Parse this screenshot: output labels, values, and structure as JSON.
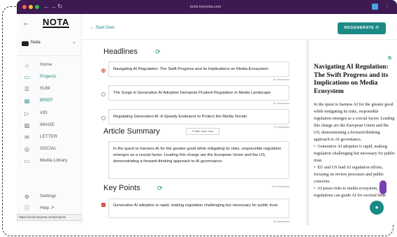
{
  "browser": {
    "url": "tools.heynota.com",
    "status_url": "https://tools.heynota.com/projects"
  },
  "sidebar": {
    "logo": "NOTA",
    "workspace": "Nota",
    "items": [
      {
        "label": "Home",
        "icon": "home-icon"
      },
      {
        "label": "Projects",
        "icon": "folder-icon",
        "active": true
      },
      {
        "label": "SUM",
        "icon": "list-icon"
      },
      {
        "label": "BRIEF",
        "icon": "document-icon",
        "active": true
      },
      {
        "label": "VID",
        "icon": "video-icon"
      },
      {
        "label": "IMAGE",
        "icon": "image-icon"
      },
      {
        "label": "LETTER",
        "icon": "mail-icon"
      },
      {
        "label": "SOCIAL",
        "icon": "social-icon"
      },
      {
        "label": "Media Library",
        "icon": "folder-icon"
      },
      {
        "label": "Settings",
        "icon": "gear-icon"
      },
      {
        "label": "Help ↗",
        "icon": "help-icon"
      }
    ]
  },
  "topbar": {
    "back_label": "Start Over",
    "regenerate_label": "REGENERATE"
  },
  "headlines": {
    "title": "Headlines",
    "items": [
      {
        "text": "Navigating AI Regulation: The Swift Progress and its Implications on Media Ecosystem",
        "chars": "84 characters",
        "selected": true
      },
      {
        "text": "The Surge in Generative AI Adoption Demands Prudent Regulation in Media Landscape",
        "chars": "81 characters",
        "selected": false
      },
      {
        "text": "Regulating Generative AI: A Speedy Endeavor to Protect the Media Terrain",
        "chars": "72 characters",
        "selected": false
      }
    ]
  },
  "summary": {
    "title": "Article Summary",
    "tone_button": "Alter Note Tone",
    "text": "In the quest to harness AI for the greater good while mitigating its risks, responsible regulation emerges as a crucial factor. Leading this charge are the European Union and the US, demonstrating a forward-thinking approach to AI governance.",
    "chars": "242 characters"
  },
  "key_points": {
    "title": "Key Points",
    "items": [
      {
        "text": "Generative AI adoption is rapid, making regulation challenging but necessary for public trust.",
        "chars": "94 characters"
      }
    ]
  },
  "preview": {
    "title": "Navigating AI Regulation: The Swift Progress and its Implications on Media Ecosystem",
    "body": "In the quest to harness AI for the greater good while mitigating its risks, responsible regulation emerges as a crucial factor. Leading this charge are the European Union and the US, demonstrating a forward-thinking approach to AI governance.",
    "bullets": [
      "Generative AI adoption is rapid, making regulation challenging but necessary for public trust.",
      "EU and US lead AI regulation efforts, focusing on review processes and public concerns.",
      "AI poses risks to media ecosystem, but regulations can guide AI for societal bene"
    ]
  },
  "colors": {
    "accent": "#1b8a86",
    "frame": "#3d1a52",
    "selected": "#d9534f"
  }
}
